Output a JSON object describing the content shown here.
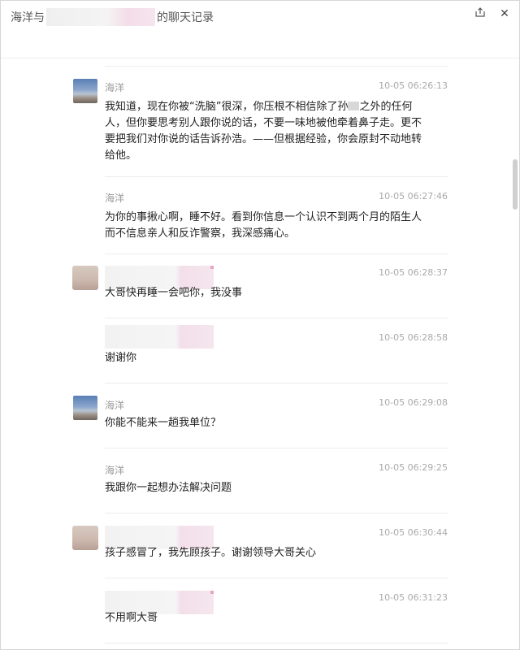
{
  "window": {
    "title_prefix": "海洋与",
    "title_suffix": "的聊天记录",
    "share_icon": "share-icon",
    "close_glyph": "✕"
  },
  "messages": [
    {
      "sender": "海洋",
      "time": "10-05 06:26:13",
      "text_before_mask": "我知道，现在你被“洗脑”很深，你压根不相信除了孙",
      "text_after_mask": "之外的任何人，但你要思考别人跟你说的话，不要一味地被他牵着鼻子走。更不要把我们对你说的话告诉孙浩。——但根据经验，你会原封不动地转给他。"
    },
    {
      "sender": "海洋",
      "time": "10-05 06:27:46",
      "text": "为你的事揪心啊，睡不好。看到你信息一个认识不到两个月的陌生人而不信息亲人和反诈警察，我深感痛心。"
    },
    {
      "sender": "",
      "time": "10-05 06:28:37",
      "text": "大哥快再睡一会吧你，我没事"
    },
    {
      "sender": "",
      "time": "10-05 06:28:58",
      "text": "谢谢你"
    },
    {
      "sender": "海洋",
      "time": "10-05 06:29:08",
      "text": "你能不能来一趟我单位？"
    },
    {
      "sender": "海洋",
      "time": "10-05 06:29:25",
      "text": "我跟你一起想办法解决问题"
    },
    {
      "sender": "",
      "time": "10-05 06:30:44",
      "text": "孩子感冒了，我先顾孩子。谢谢领导大哥关心"
    },
    {
      "sender": "",
      "time": "10-05 06:31:23",
      "text": "不用啊大哥"
    }
  ]
}
